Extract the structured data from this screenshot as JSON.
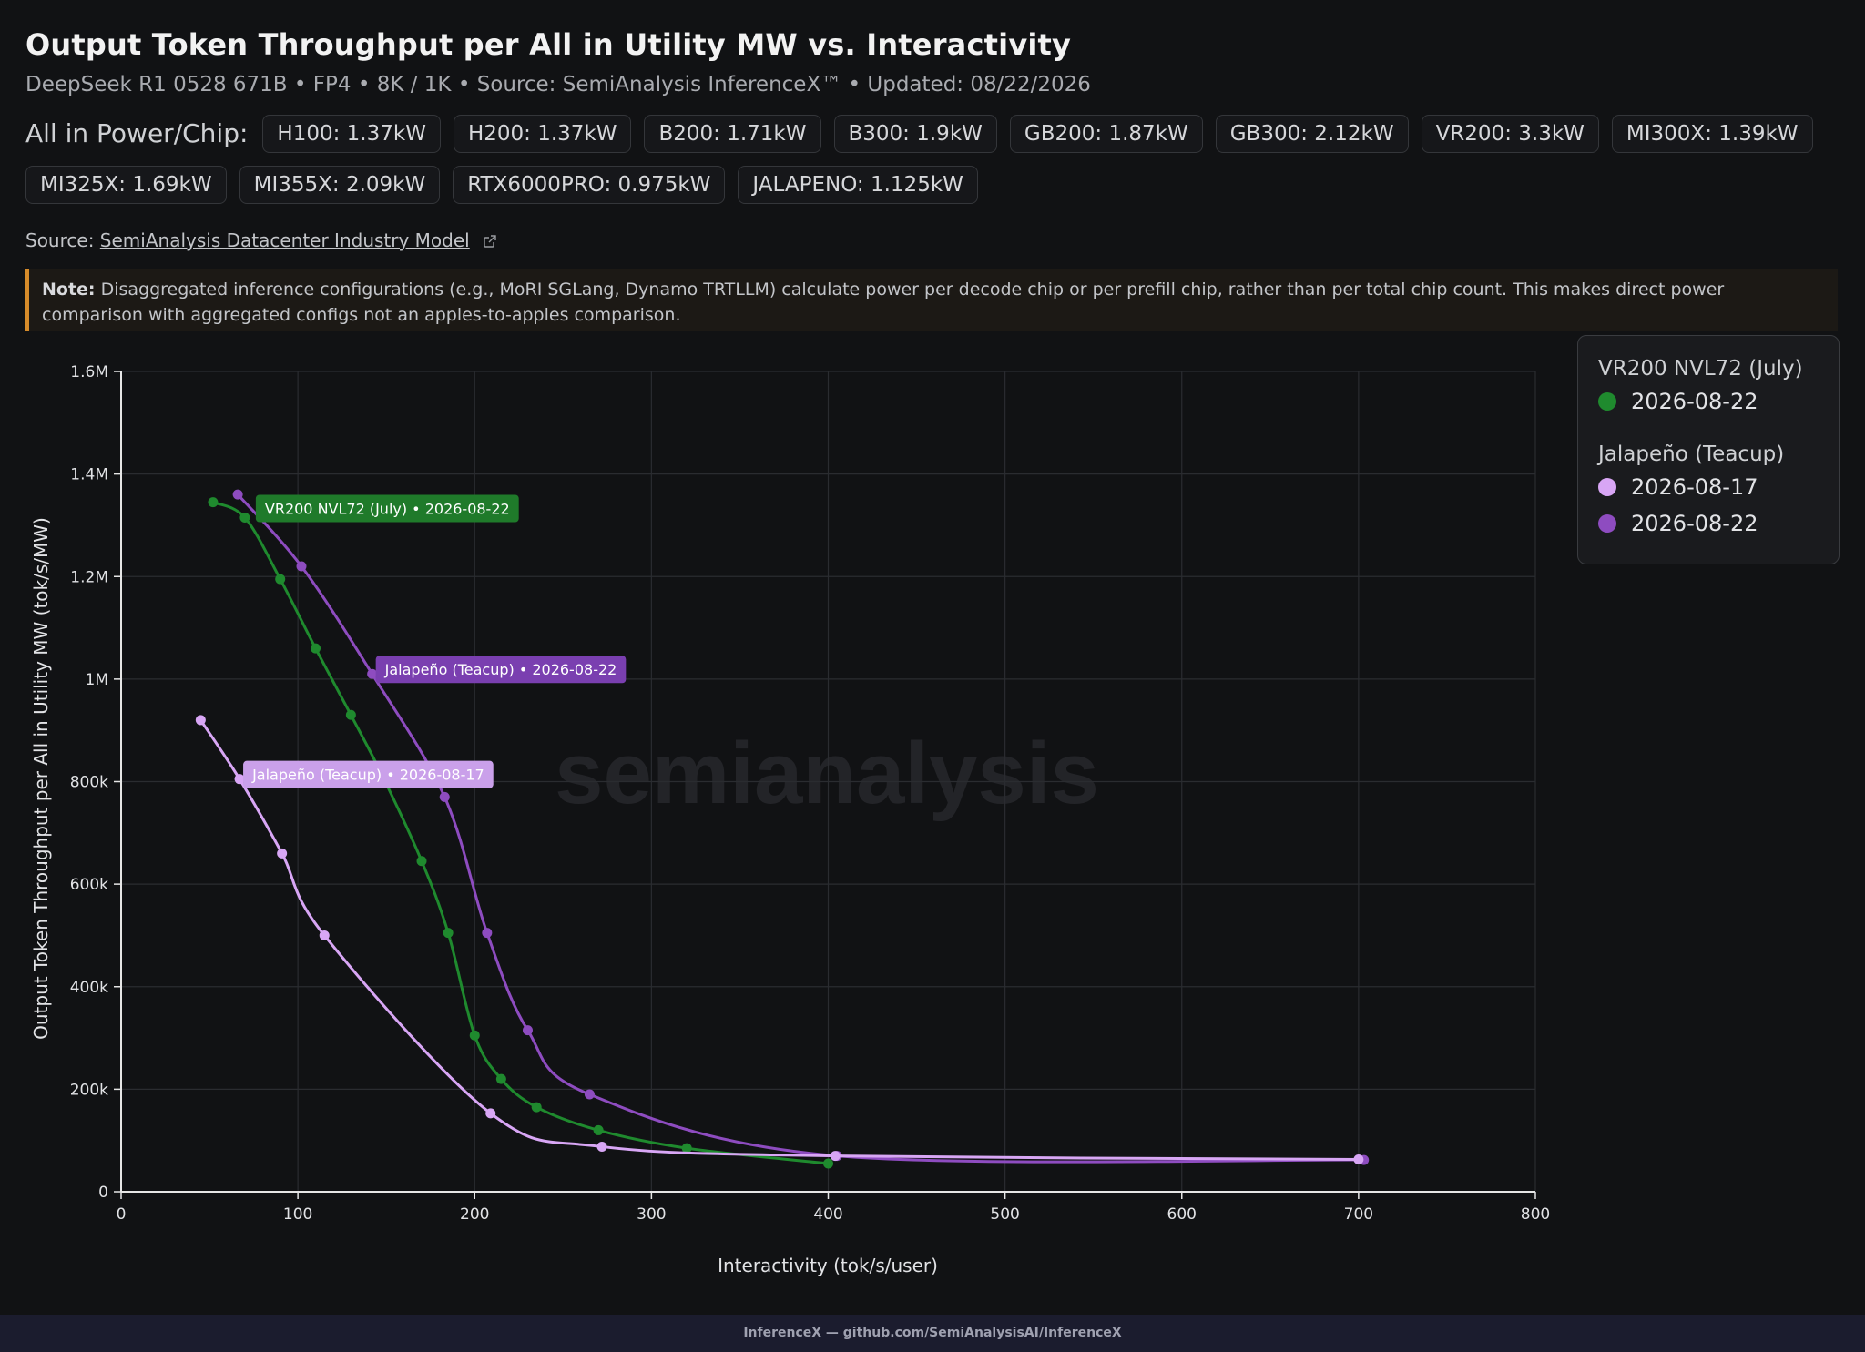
{
  "header": {
    "title": "Output Token Throughput per All in Utility MW vs. Interactivity",
    "subtitle": "DeepSeek R1 0528 671B • FP4 • 8K / 1K • Source: SemiAnalysis InferenceX™ • Updated: 08/22/2026"
  },
  "power": {
    "label": "All in Power/Chip:",
    "chips": [
      "H100: 1.37kW",
      "H200: 1.37kW",
      "B200: 1.71kW",
      "B300: 1.9kW",
      "GB200: 1.87kW",
      "GB300: 2.12kW",
      "VR200: 3.3kW",
      "MI300X: 1.39kW",
      "MI325X: 1.69kW",
      "MI355X: 2.09kW",
      "RTX6000PRO: 0.975kW",
      "JALAPENO: 1.125kW"
    ]
  },
  "source": {
    "prefix": "Source:",
    "link_text": "SemiAnalysis Datacenter Industry Model"
  },
  "note": {
    "label": "Note:",
    "text": "Disaggregated inference configurations (e.g., MoRI SGLang, Dynamo TRTLLM) calculate power per decode chip or per prefill chip, rather than per total chip count. This makes direct power comparison with aggregated configs not an apples-to-apples comparison."
  },
  "watermark": "semianalysis",
  "legend": {
    "groups": [
      {
        "title": "VR200 NVL72 (July)",
        "items": [
          {
            "label": "2026-08-22",
            "color": "#1f8a2e"
          }
        ]
      },
      {
        "title": "Jalapeño (Teacup)",
        "items": [
          {
            "label": "2026-08-17",
            "color": "#d8a6f5"
          },
          {
            "label": "2026-08-22",
            "color": "#8e4cc0"
          }
        ]
      }
    ]
  },
  "footer": "InferenceX — github.com/SemiAnalysisAI/InferenceX",
  "chart_data": {
    "type": "line",
    "xlabel": "Interactivity (tok/s/user)",
    "ylabel": "Output Token Throughput per All in Utility MW (tok/s/MW)",
    "xlim": [
      0,
      800
    ],
    "ylim": [
      0,
      1600000
    ],
    "x_ticks": [
      0,
      100,
      200,
      300,
      400,
      500,
      600,
      700,
      800
    ],
    "x_tick_labels": [
      "0",
      "100",
      "200",
      "300",
      "400",
      "500",
      "600",
      "700",
      "800"
    ],
    "y_ticks": [
      0,
      200000,
      400000,
      600000,
      800000,
      1000000,
      1200000,
      1400000,
      1600000
    ],
    "y_tick_labels": [
      "0",
      "200k",
      "400k",
      "600k",
      "800k",
      "1M",
      "1.2M",
      "1.4M",
      "1.6M"
    ],
    "grid": true,
    "legend_position": "top-right",
    "series": [
      {
        "name": "VR200 NVL72 (July) • 2026-08-22",
        "color": "#1f8a2e",
        "label_color": "#1f7a2a",
        "x": [
          52,
          70,
          90,
          110,
          130,
          148,
          170,
          185,
          200,
          215,
          235,
          270,
          320,
          400
        ],
        "y": [
          1345000,
          1315000,
          1195000,
          1060000,
          930000,
          810000,
          645000,
          505000,
          305000,
          220000,
          165000,
          120000,
          85000,
          55000
        ]
      },
      {
        "name": "Jalapeño (Teacup) • 2026-08-22",
        "color": "#8e4cc0",
        "label_color": "#7a3fb0",
        "x": [
          66,
          102,
          142,
          183,
          207,
          230,
          265,
          405,
          703
        ],
        "y": [
          1360000,
          1220000,
          1010000,
          770000,
          505000,
          315000,
          190000,
          70000,
          62000
        ]
      },
      {
        "name": "Jalapeño (Teacup) • 2026-08-17",
        "color": "#d8a6f5",
        "label_color": "#caa0ea",
        "x": [
          45,
          67,
          91,
          115,
          209,
          272,
          404,
          700
        ],
        "y": [
          920000,
          805000,
          660000,
          500000,
          153000,
          88000,
          70000,
          63000
        ]
      }
    ]
  }
}
